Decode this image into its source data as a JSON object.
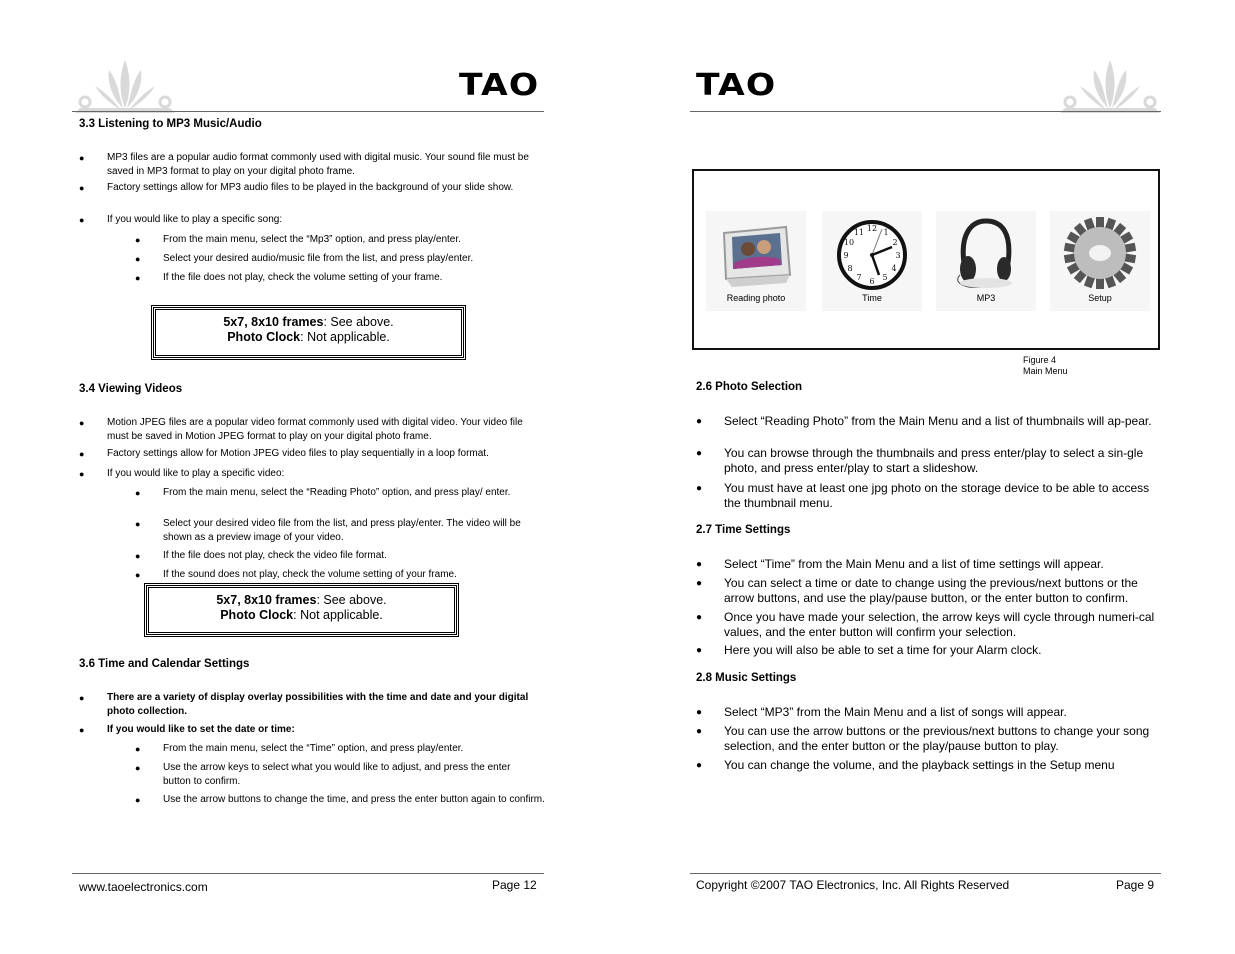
{
  "left_page": {
    "logo": "TAO",
    "sections": {
      "s33": {
        "title": "3.3 Listening to MP3 Music/Audio",
        "bullets": [
          "MP3 files are a popular audio format commonly used with digital music.  Your sound file must be saved in MP3 format to play on your digital photo frame.",
          "Factory settings allow for MP3 audio files to be played in the background of your slide show.",
          "If you would like to play a specific song:"
        ],
        "sub_bullets": [
          "From the main menu, select the “Mp3” option, and press play/enter.",
          "Select your desired audio/music file from the list, and press play/enter.",
          "If the file does not play, check the volume setting of your frame."
        ],
        "note": {
          "line1_bold": "5x7, 8x10 frames",
          "line1_rest": ": See above.",
          "line2_bold": "Photo Clock",
          "line2_rest": ": Not applicable."
        }
      },
      "s34": {
        "title": "3.4 Viewing Videos",
        "bullets": [
          "Motion JPEG files are a popular video format commonly used with digital video.  Your video file must be saved in Motion JPEG format to play on your digital photo frame.",
          "Factory settings allow for Motion JPEG video files to play sequentially in a loop format.",
          "If you would like to play a specific video:"
        ],
        "sub_bullets": [
          "From the main menu, select the “Reading Photo” option, and press play/ enter.",
          "Select your desired video file from the list, and press play/enter.  The video will be shown as a preview image of your video.",
          "If the file does not play, check the video file format.",
          "If the sound does not play, check the volume setting of your frame."
        ],
        "note": {
          "line1_bold": "5x7, 8x10 frames",
          "line1_rest": ": See above.",
          "line2_bold": "Photo Clock",
          "line2_rest": ": Not applicable."
        }
      },
      "s36": {
        "title": "3.6  Time and Calendar Settings",
        "bullets": [
          "There are a variety of display overlay possibilities with the time and date and your digital photo collection.",
          "If you would like to set the date or time:"
        ],
        "sub_bullets": [
          "From the main menu, select the “Time” option, and press play/enter.",
          "Use the arrow keys to select what you would like to adjust, and press the enter button to confirm.",
          "Use the arrow buttons to change the time, and press the enter button again to confirm."
        ]
      }
    },
    "footer": {
      "left": "www.taoelectronics.com",
      "right": "Page 12"
    }
  },
  "right_page": {
    "logo": "TAO",
    "figure": {
      "menu_items": [
        {
          "label": "Reading photo",
          "icon": "photo-frame-icon"
        },
        {
          "label": "Time",
          "icon": "clock-icon"
        },
        {
          "label": "MP3",
          "icon": "headphones-icon"
        },
        {
          "label": "Setup",
          "icon": "gear-icon"
        }
      ],
      "caption_line1": "Figure 4",
      "caption_line2": "Main Menu"
    },
    "sections": {
      "s26": {
        "title": "2.6 Photo Selection",
        "bullets": [
          "Select “Reading Photo” from the Main Menu and a list of thumbnails will ap-pear.",
          "You can browse through the thumbnails and press enter/play to select a sin-gle photo, and press enter/play to start a slideshow.",
          "You must have at least one jpg photo on the storage device to be able to access the thumbnail menu."
        ]
      },
      "s27": {
        "title": "2.7 Time Settings",
        "bullets": [
          "Select “Time” from the Main Menu and a list of time settings will appear.",
          "You can select a time or date to change using the previous/next buttons or the arrow buttons, and use the play/pause button, or the enter button to confirm.",
          "Once you have made your selection, the arrow keys will cycle through numeri-cal values, and the enter button will confirm your selection.",
          "Here you will also be able to set a time for your Alarm clock."
        ]
      },
      "s28": {
        "title": "2.8 Music Settings",
        "bullets": [
          "Select “MP3” from the Main Menu and a list of songs will appear.",
          "You can use the arrow buttons or the previous/next buttons to change your song selection, and the enter button or the play/pause button to play.",
          "You can change the volume, and the playback settings in the Setup menu"
        ]
      }
    },
    "footer": {
      "left": "Copyright ©2007 TAO Electronics, Inc. All Rights Reserved",
      "right": "Page 9"
    }
  }
}
